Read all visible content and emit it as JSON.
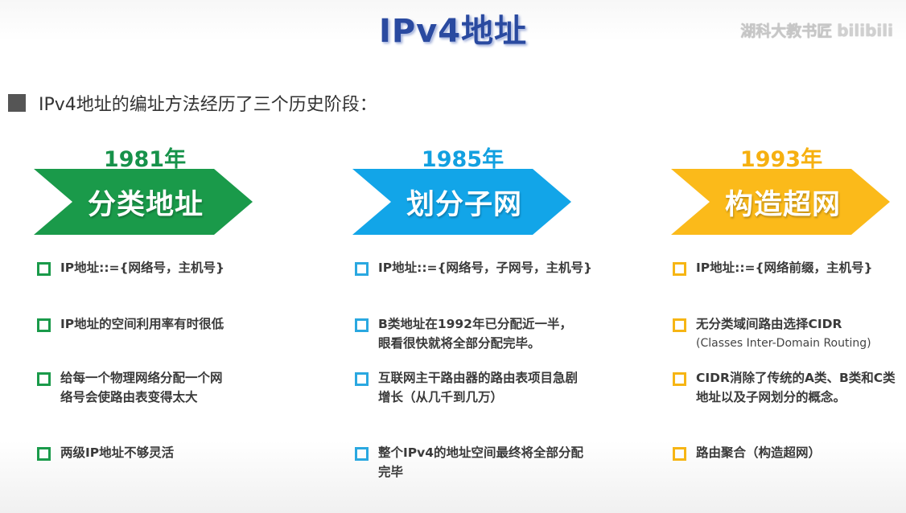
{
  "slide": {
    "title": "IPv4地址",
    "watermark": "湖科大教书匠",
    "watermark_logo": "bilibili",
    "intro": "IPv4地址的编址方法经历了三个历史阶段："
  },
  "colors": {
    "green": "#1a9a4a",
    "blue": "#12a5e8",
    "yellow": "#fbba1a",
    "title": "#2a4aa0"
  },
  "stages": [
    {
      "year": "1981年",
      "label": "分类地址",
      "items": [
        {
          "text": "IP地址::={网络号，主机号}"
        },
        {
          "text": "IP地址的空间利用率有时很低"
        },
        {
          "text": "给每一个物理网络分配一个网络号会使路由表变得太大"
        },
        {
          "text": "两级IP地址不够灵活"
        }
      ]
    },
    {
      "year": "1985年",
      "label": "划分子网",
      "items": [
        {
          "text": "IP地址::={网络号，子网号，主机号}"
        },
        {
          "text": "B类地址在1992年已分配近一半，眼看很快就将全部分配完毕。"
        },
        {
          "text": "互联网主干路由器的路由表项目急剧增长（从几千到几万）"
        },
        {
          "text": "整个IPv4的地址空间最终将全部分配完毕"
        }
      ]
    },
    {
      "year": "1993年",
      "label": "构造超网",
      "items": [
        {
          "text": "IP地址::={网络前缀，主机号}"
        },
        {
          "text": "无分类域间路由选择CIDR",
          "sub": "(Classes Inter-Domain Routing)"
        },
        {
          "text": "CIDR消除了传统的A类、B类和C类地址以及子网划分的概念。"
        },
        {
          "text": "路由聚合（构造超网）"
        }
      ]
    }
  ]
}
